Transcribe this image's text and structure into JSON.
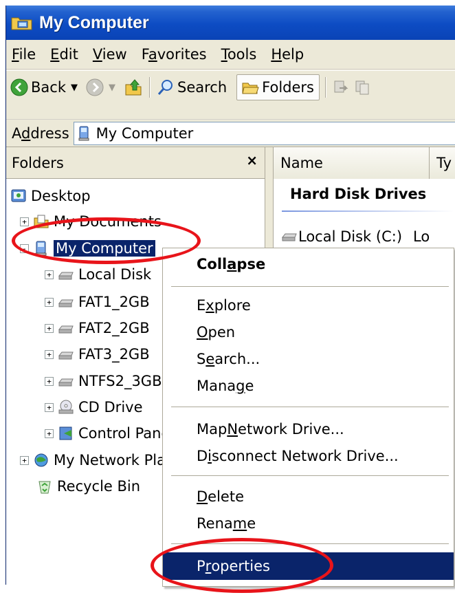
{
  "window": {
    "title": "My Computer"
  },
  "menubar": {
    "items": [
      {
        "pre": "",
        "key": "F",
        "post": "ile"
      },
      {
        "pre": "",
        "key": "E",
        "post": "dit"
      },
      {
        "pre": "",
        "key": "V",
        "post": "iew"
      },
      {
        "pre": "F",
        "key": "a",
        "post": "vorites"
      },
      {
        "pre": "",
        "key": "T",
        "post": "ools"
      },
      {
        "pre": "",
        "key": "H",
        "post": "elp"
      }
    ]
  },
  "toolbar": {
    "back_label": "Back",
    "search_label": "Search",
    "folders_label": "Folders"
  },
  "address": {
    "label_pre": "A",
    "label_key": "d",
    "label_post": "dress",
    "value": "My Computer"
  },
  "folders_pane": {
    "title": "Folders",
    "close_glyph": "×",
    "tree": [
      {
        "label": "Desktop",
        "expander": "",
        "icon": "desktop-icon"
      },
      {
        "label": "My Documents",
        "expander": "+",
        "icon": "my-documents-icon"
      },
      {
        "label": "My Computer",
        "expander": "-",
        "icon": "my-computer-icon",
        "selected": true
      },
      {
        "label": "Local Disk",
        "expander": "+",
        "icon": "hard-disk-icon"
      },
      {
        "label": "FAT1_2GB",
        "expander": "+",
        "icon": "hard-disk-icon"
      },
      {
        "label": "FAT2_2GB",
        "expander": "+",
        "icon": "hard-disk-icon"
      },
      {
        "label": "FAT3_2GB",
        "expander": "+",
        "icon": "hard-disk-icon"
      },
      {
        "label": "NTFS2_3GB",
        "expander": "+",
        "icon": "hard-disk-icon"
      },
      {
        "label": "CD Drive",
        "expander": "+",
        "icon": "cd-drive-icon"
      },
      {
        "label": "Control Panel",
        "expander": "+",
        "icon": "control-panel-icon"
      },
      {
        "label": "My Network Places",
        "expander": "+",
        "icon": "network-places-icon"
      },
      {
        "label": "Recycle Bin",
        "expander": "",
        "icon": "recycle-bin-icon"
      }
    ]
  },
  "list_pane": {
    "columns": [
      "Name",
      "Ty"
    ],
    "group_title": "Hard Disk Drives",
    "rows": [
      {
        "name": "Local Disk (C:)",
        "type": "Lo"
      }
    ]
  },
  "context_menu": {
    "items": [
      {
        "pre": "Coll",
        "key": "a",
        "post": "pse",
        "bold": true
      },
      {
        "pre": "E",
        "key": "x",
        "post": "plore"
      },
      {
        "pre": "",
        "key": "O",
        "post": "pen"
      },
      {
        "pre": "S",
        "key": "e",
        "post": "arch..."
      },
      {
        "pre": "Mana",
        "key": "g",
        "post": "e"
      },
      {
        "pre": "Map ",
        "key": "N",
        "post": "etwork Drive..."
      },
      {
        "pre": "D",
        "key": "i",
        "post": "sconnect Network Drive..."
      },
      {
        "pre": "",
        "key": "D",
        "post": "elete"
      },
      {
        "pre": "Rena",
        "key": "m",
        "post": "e"
      },
      {
        "pre": "P",
        "key": "r",
        "post": "operties",
        "highlight": true
      }
    ]
  },
  "annotation": {
    "color": "#e8141a"
  }
}
